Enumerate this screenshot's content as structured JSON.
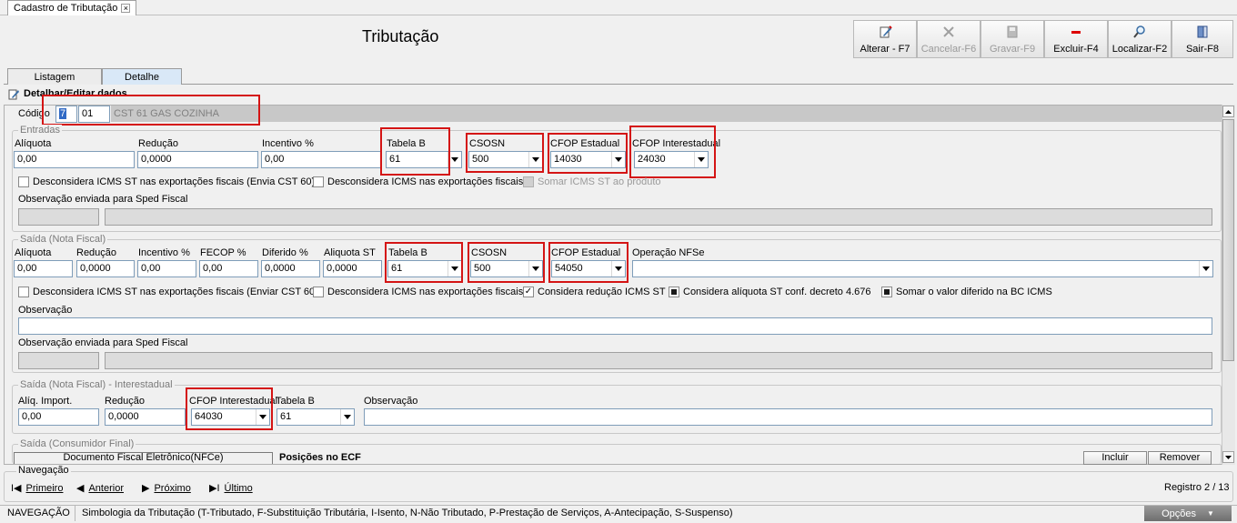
{
  "window": {
    "tab_title": "Cadastro de Tributação",
    "tab_close": "×"
  },
  "page": {
    "title": "Tributação"
  },
  "toolbar": [
    {
      "label": "Alterar - F7",
      "icon": "edit-icon",
      "enabled": true
    },
    {
      "label": "Cancelar-F6",
      "icon": "cancel-icon",
      "enabled": false
    },
    {
      "label": "Gravar-F9",
      "icon": "save-icon",
      "enabled": false
    },
    {
      "label": "Excluir-F4",
      "icon": "delete-icon",
      "enabled": true
    },
    {
      "label": "Localizar-F2",
      "icon": "search-icon",
      "enabled": true
    },
    {
      "label": "Sair-F8",
      "icon": "exit-door-icon",
      "enabled": true
    }
  ],
  "tabs": {
    "listagem": "Listagem",
    "detalhe": "Detalhe"
  },
  "detail": {
    "header": "Detalhar/Editar dados",
    "codigo_label": "Código",
    "codigo_value": "7",
    "codigo_cst": "01",
    "codigo_desc": "CST 61 GAS COZINHA"
  },
  "entradas": {
    "title": "Entradas",
    "aliquota_label": "Alíquota",
    "aliquota": "0,00",
    "reducao_label": "Redução",
    "reducao": "0,0000",
    "incentivo_label": "Incentivo %",
    "incentivo": "0,00",
    "tabela_b_label": "Tabela B",
    "tabela_b": "61",
    "csosn_label": "CSOSN",
    "csosn": "500",
    "cfop_estadual_label": "CFOP Estadual",
    "cfop_estadual": "14030",
    "cfop_interestadual_label": "CFOP Interestadual",
    "cfop_interestadual": "24030",
    "chk1": "Desconsidera ICMS ST nas exportações fiscais (Envia CST 60)",
    "chk2": "Desconsidera ICMS nas exportações fiscais",
    "chk3": "Somar ICMS ST ao produto",
    "obs_sped_label": "Observação enviada para Sped Fiscal"
  },
  "saida": {
    "title": "Saída (Nota Fiscal)",
    "aliquota_label": "Alíquota",
    "aliquota": "0,00",
    "reducao_label": "Redução",
    "reducao": "0,0000",
    "incentivo_label": "Incentivo %",
    "incentivo": "0,00",
    "fecop_label": "FECOP %",
    "fecop": "0,00",
    "diferido_label": "Diferido %",
    "diferido": "0,0000",
    "aliquota_st_label": "Aliquota ST",
    "aliquota_st": "0,0000",
    "tabela_b_label": "Tabela B",
    "tabela_b": "61",
    "csosn_label": "CSOSN",
    "csosn": "500",
    "cfop_estadual_label": "CFOP Estadual",
    "cfop_estadual": "54050",
    "operacao_nfse_label": "Operação NFSe",
    "operacao_nfse": "",
    "chk1": "Desconsidera ICMS ST nas exportações fiscais (Enviar CST 60)",
    "chk2": "Desconsidera ICMS nas exportações fiscais",
    "chk3": "Considera redução ICMS ST",
    "chk4": "Considera alíquota ST conf. decreto 4.676",
    "chk5": "Somar o valor diferido na BC ICMS",
    "obs_label": "Observação",
    "obs_sped_label": "Observação enviada para Sped Fiscal"
  },
  "interestadual": {
    "title": "Saída (Nota Fiscal) - Interestadual",
    "aliq_import_label": "Alíq. Import.",
    "aliq_import": "0,00",
    "reducao_label": "Redução",
    "reducao": "0,0000",
    "cfop_interestadual_label": "CFOP Interestadual",
    "cfop_interestadual": "64030",
    "tabela_b_label": "Tabela B",
    "tabela_b": "61",
    "obs_label": "Observação"
  },
  "consumidor": {
    "title": "Saída (Consumidor Final)",
    "nfce_tab": "Documento Fiscal Eletrônico(NFCe)",
    "posicoes_label": "Posições no ECF",
    "incluir": "Incluir",
    "remover": "Remover"
  },
  "navigation": {
    "title": "Navegação",
    "primeiro": "Primeiro",
    "anterior": "Anterior",
    "proximo": "Próximo",
    "ultimo": "Último",
    "registro": "Registro 2 / 13"
  },
  "statusbar": {
    "mode": "NAVEGAÇÃO",
    "legend": "Simbologia da Tributação (T-Tributado, F-Substituição Tributária, I-Isento, N-Não Tributado, P-Prestação de Serviços, A-Antecipação, S-Suspenso)",
    "opcoes": "Opções"
  },
  "colors": {
    "highlight_border": "#d41414",
    "tab_active": "#d9e8f7"
  }
}
